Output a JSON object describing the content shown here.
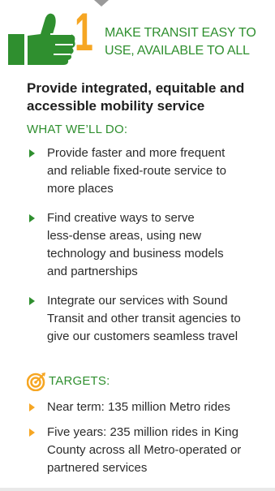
{
  "header": {
    "number": "1",
    "title_lines": [
      "MAKE TRANSIT EASY TO",
      "USE, AVAILABLE TO ALL"
    ]
  },
  "subtitle_lines": [
    "Provide integrated, equitable and",
    "accessible mobility service"
  ],
  "what_we_do": {
    "heading": "WHAT WE’LL DO:",
    "items": [
      {
        "lines": [
          "Provide faster and more frequent",
          "and reliable fixed-route service to",
          "more places"
        ]
      },
      {
        "lines": [
          "Find creative ways to serve",
          "less-dense areas, using new",
          "technology and business models",
          "and partnerships"
        ]
      },
      {
        "lines": [
          "Integrate our services with Sound",
          "Transit and other transit agencies to",
          "give our customers seamless travel"
        ]
      }
    ]
  },
  "targets": {
    "heading": "TARGETS:",
    "items": [
      {
        "lines": [
          "Near term: 135 million Metro rides"
        ]
      },
      {
        "lines": [
          "Five years: 235 million rides in King",
          "County across all Metro-operated or",
          "partnered services"
        ]
      }
    ]
  },
  "colors": {
    "green": "#2f8f2f",
    "orange": "#f6a623",
    "text": "#2b2b2b"
  },
  "icons": [
    "thumbs-up-icon",
    "target-icon",
    "bullet-arrow-icon"
  ]
}
